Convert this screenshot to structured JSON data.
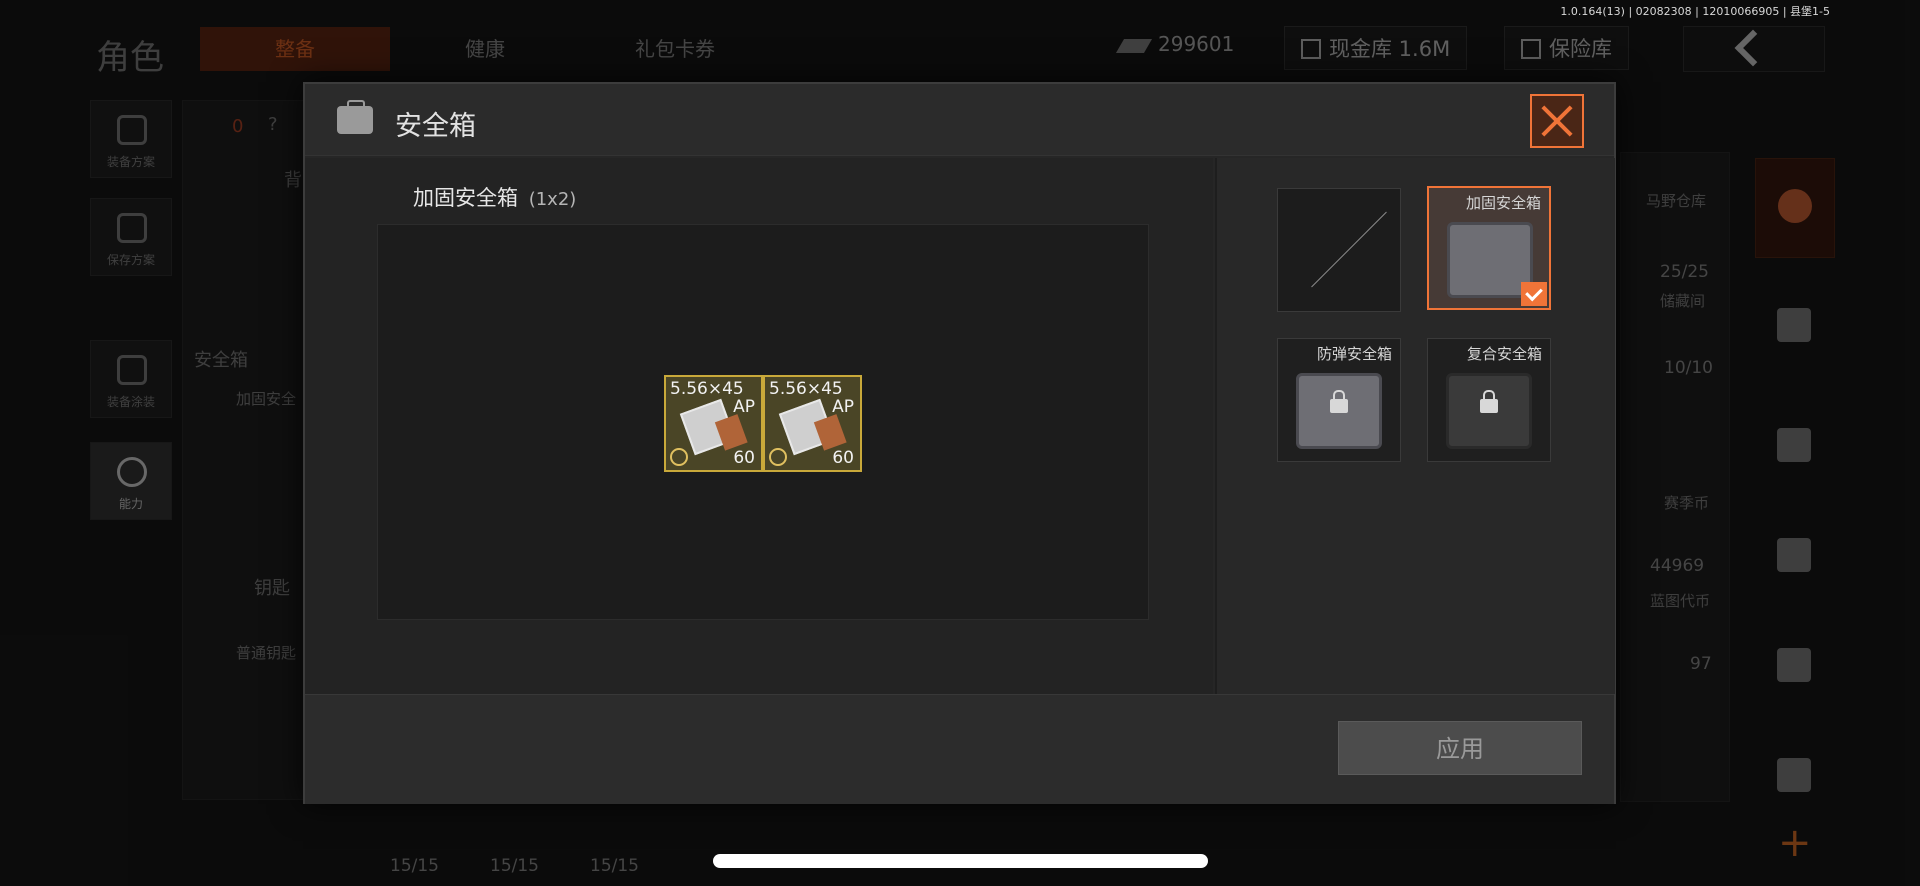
{
  "status_bar": {
    "version": "1.0.164(13) | 02082308 | 12010066905 | 县堡1-5"
  },
  "top": {
    "title": "角色",
    "tabs": [
      {
        "label": "整备",
        "active": true
      },
      {
        "label": "健康",
        "active": false
      },
      {
        "label": "礼包卡券",
        "active": false
      }
    ],
    "money": "299601",
    "cash_vault": "现金库 1.6M",
    "safe_vault": "保险库"
  },
  "sidebar": {
    "items": [
      {
        "label": "装备方案"
      },
      {
        "label": "保存方案"
      },
      {
        "label": "装备涂装"
      },
      {
        "label": "能力"
      }
    ]
  },
  "background": {
    "counter": "0",
    "help": "?",
    "backpack_label": "背",
    "safe_box_label": "安全箱",
    "safe_box_item": "加固安全",
    "key_label": "钥匙",
    "normal_key": "普通钥匙",
    "key_counts": [
      "15/15",
      "15/15",
      "15/15"
    ],
    "right_items": [
      {
        "name": "马野仓库",
        "count": "25/25"
      },
      {
        "name": "储藏间",
        "count": "10/10"
      },
      {
        "name": "赛季币",
        "count": "44969"
      },
      {
        "name": "蓝图代币",
        "count": "97"
      }
    ]
  },
  "modal": {
    "title": "安全箱",
    "case_name": "加固安全箱",
    "case_size": "(1x2)",
    "items": [
      {
        "caliber": "5.56×45",
        "type": "AP",
        "quantity": "60"
      },
      {
        "caliber": "5.56×45",
        "type": "AP",
        "quantity": "60"
      }
    ],
    "case_options": [
      {
        "label": "",
        "state": "empty"
      },
      {
        "label": "加固安全箱",
        "state": "selected"
      },
      {
        "label": "防弹安全箱",
        "state": "locked"
      },
      {
        "label": "复合安全箱",
        "state": "locked"
      }
    ],
    "apply_label": "应用"
  },
  "colors": {
    "accent": "#f07438",
    "item_border": "#c9a93a"
  }
}
